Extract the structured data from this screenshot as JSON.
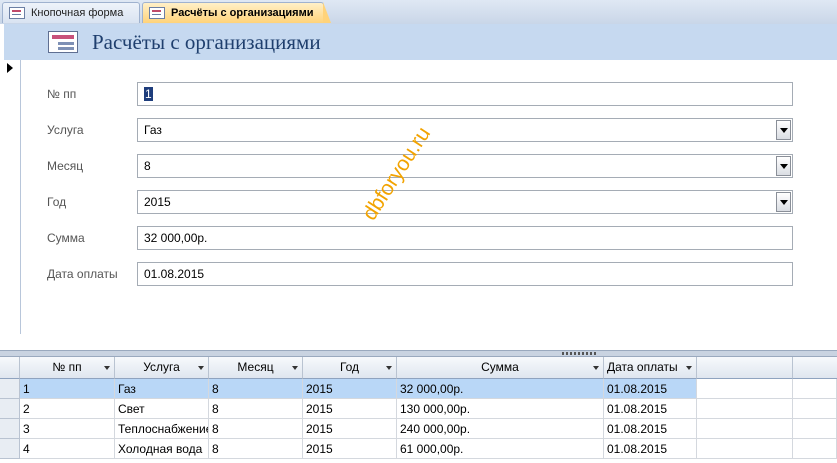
{
  "tabs": [
    {
      "label": "Кнопочная форма",
      "active": false
    },
    {
      "label": "Расчёты с организациями",
      "active": true
    }
  ],
  "form": {
    "title": "Расчёты с организациями",
    "fields": {
      "num_label": "№ пп",
      "num_value": "1",
      "service_label": "Услуга",
      "service_value": "Газ",
      "month_label": "Месяц",
      "month_value": "8",
      "year_label": "Год",
      "year_value": "2015",
      "sum_label": "Сумма",
      "sum_value": "32 000,00р.",
      "date_label": "Дата оплаты",
      "date_value": "01.08.2015"
    }
  },
  "watermark": "dbforyou.ru",
  "datasheet": {
    "columns": [
      "№ пп",
      "Услуга",
      "Месяц",
      "Год",
      "Сумма",
      "Дата оплаты"
    ],
    "rows": [
      [
        "1",
        "Газ",
        "8",
        "2015",
        "32 000,00р.",
        "01.08.2015"
      ],
      [
        "2",
        "Свет",
        "8",
        "2015",
        "130 000,00р.",
        "01.08.2015"
      ],
      [
        "3",
        "Теплоснабжение",
        "8",
        "2015",
        "240 000,00р.",
        "01.08.2015"
      ],
      [
        "4",
        "Холодная вода",
        "8",
        "2015",
        "61 000,00р.",
        "01.08.2015"
      ]
    ]
  },
  "colors": {
    "header_bg": "#c6d9f0",
    "title": "#1f3f6e",
    "selected_row": "#b9d7f7",
    "watermark": "#f2a300",
    "active_tab": "#ffd37a"
  }
}
